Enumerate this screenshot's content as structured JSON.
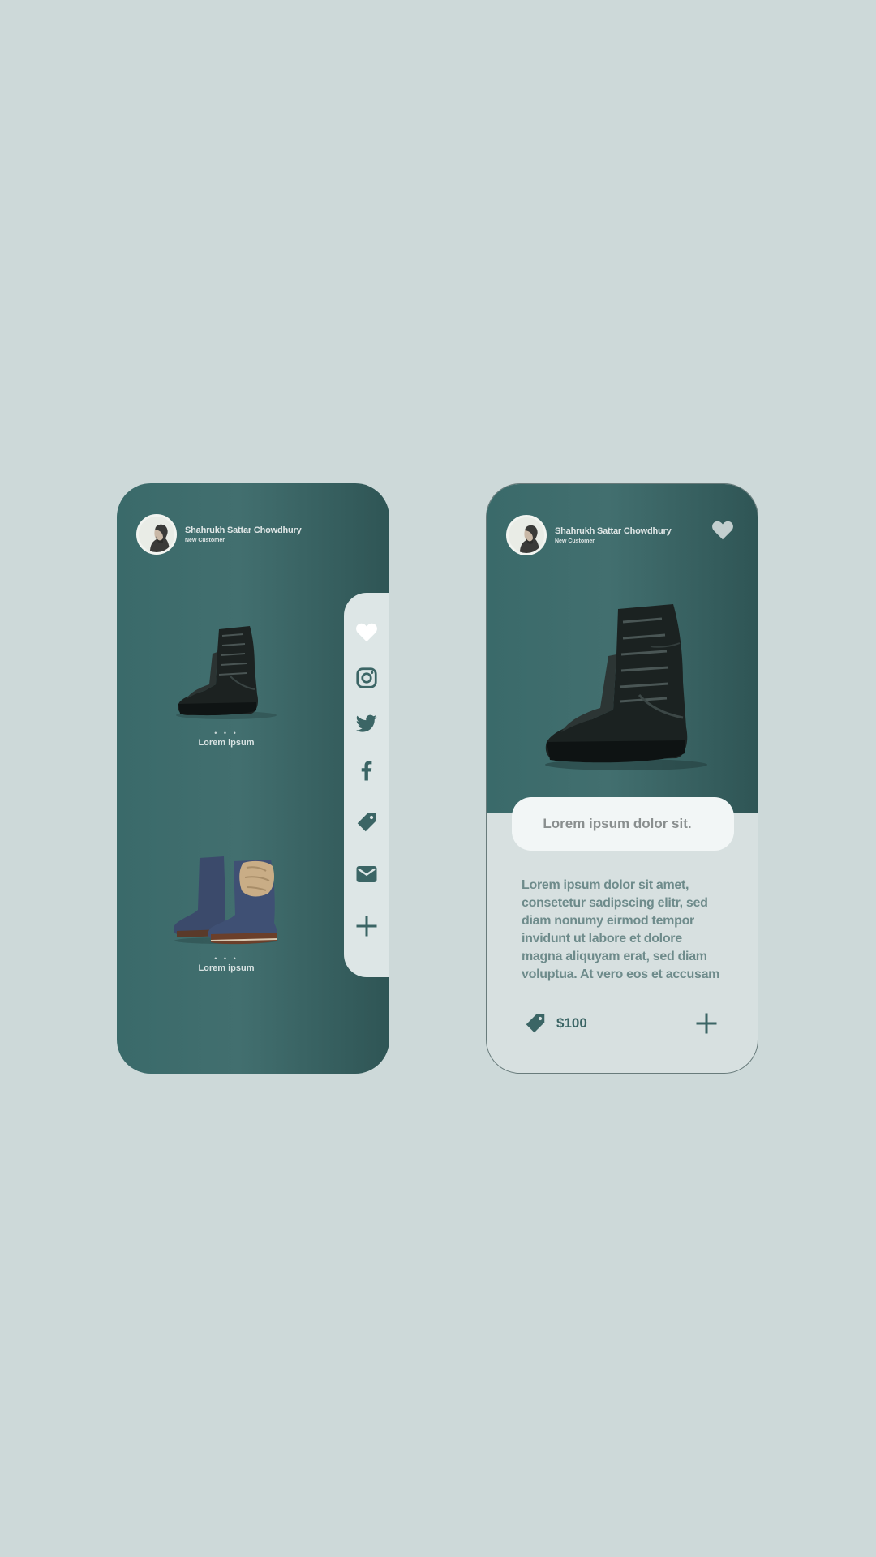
{
  "colors": {
    "background": "#cdd9d9",
    "teal_dark": "#2f5555",
    "teal": "#426f6f",
    "panel_light": "#dde6e6",
    "icon": "#3b6565"
  },
  "left_screen": {
    "profile": {
      "name": "Shahrukh Sattar Chowdhury",
      "subtitle": "New Customer"
    },
    "products": [
      {
        "dots": "• • •",
        "label": "Lorem ipsum",
        "image": "black-combat-boot"
      },
      {
        "dots": "• • •",
        "label": "Lorem ipsum",
        "image": "blue-fur-boots"
      }
    ],
    "social_bar": {
      "icons": [
        "heart-icon",
        "instagram-icon",
        "twitter-icon",
        "facebook-icon",
        "tag-icon",
        "mail-icon",
        "plus-icon"
      ]
    }
  },
  "right_screen": {
    "profile": {
      "name": "Shahrukh Sattar Chowdhury",
      "subtitle": "New Customer"
    },
    "favorite_icon": "heart-icon",
    "product_image": "black-combat-boot",
    "title": "Lorem ipsum dolor sit.",
    "description_lines": [
      "Lorem ipsum dolor sit amet,",
      "consetetur sadipscing elitr, sed",
      "diam nonumy eirmod tempor",
      "invidunt ut labore et dolore",
      "magna aliquyam erat, sed diam",
      "voluptua. At vero eos et accusam"
    ],
    "price": "$100",
    "price_icon": "tag-icon",
    "add_icon": "plus-icon"
  }
}
